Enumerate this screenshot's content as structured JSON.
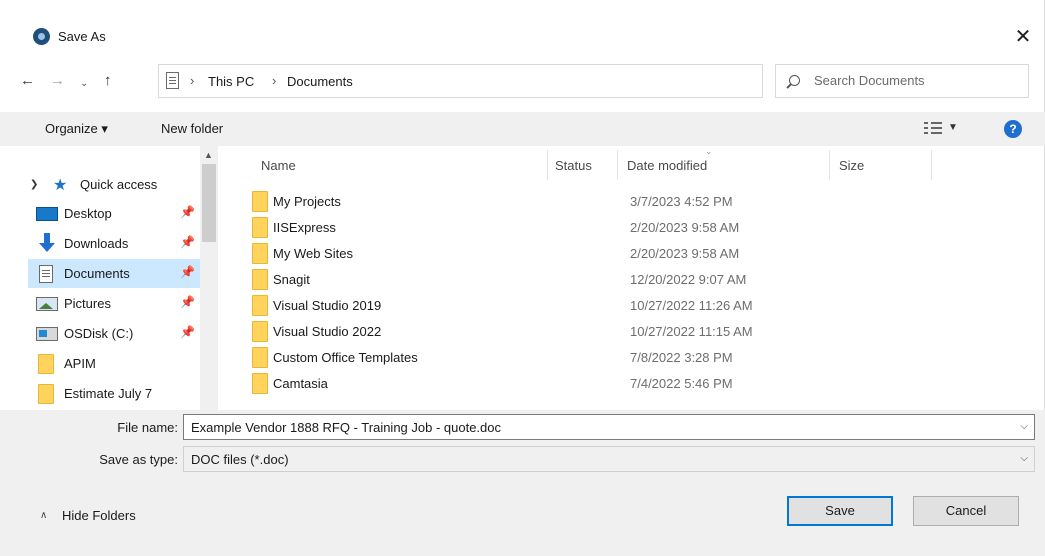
{
  "window": {
    "title": "Save As",
    "close_glyph": "✕"
  },
  "nav": {
    "back_glyph": "←",
    "forward_glyph": "→",
    "recent_glyph": "⌄",
    "up_glyph": "↑",
    "breadcrumbs": [
      "This PC",
      "Documents"
    ],
    "separator": "›",
    "search_placeholder": "Search Documents"
  },
  "toolbar": {
    "organize_label": "Organize ▾",
    "new_folder_label": "New folder",
    "view_caret": "▼",
    "help_label": "?"
  },
  "sidebar": {
    "quick_access_label": "Quick access",
    "items": [
      {
        "label": "Desktop",
        "icon": "desktop-icon",
        "pinned": true
      },
      {
        "label": "Downloads",
        "icon": "downloads-icon",
        "pinned": true
      },
      {
        "label": "Documents",
        "icon": "documents-icon",
        "pinned": true,
        "selected": true
      },
      {
        "label": "Pictures",
        "icon": "pictures-icon",
        "pinned": true
      },
      {
        "label": "OSDisk (C:)",
        "icon": "disk-icon",
        "pinned": true
      },
      {
        "label": "APIM",
        "icon": "folder-icon",
        "pinned": false
      },
      {
        "label": "Estimate July 7",
        "icon": "folder-icon",
        "pinned": false
      }
    ]
  },
  "columns": [
    "Name",
    "Status",
    "Date modified",
    "Size"
  ],
  "files": [
    {
      "name": "My Projects",
      "date": "3/7/2023 4:52 PM"
    },
    {
      "name": "IISExpress",
      "date": "2/20/2023 9:58 AM"
    },
    {
      "name": "My Web Sites",
      "date": "2/20/2023 9:58 AM"
    },
    {
      "name": "Snagit",
      "date": "12/20/2022 9:07 AM"
    },
    {
      "name": "Visual Studio 2019",
      "date": "10/27/2022 11:26 AM"
    },
    {
      "name": "Visual Studio 2022",
      "date": "10/27/2022 11:15 AM"
    },
    {
      "name": "Custom Office Templates",
      "date": "7/8/2022 3:28 PM"
    },
    {
      "name": "Camtasia",
      "date": "7/4/2022 5:46 PM"
    }
  ],
  "form": {
    "file_name_label": "File name:",
    "file_name_value": "Example Vendor 1888 RFQ - Training Job - quote.doc",
    "save_type_label": "Save as type:",
    "save_type_value": "DOC files (*.doc)",
    "hide_folders_label": "Hide Folders",
    "save_label": "Save",
    "cancel_label": "Cancel"
  },
  "colors": {
    "accent": "#0078d7",
    "selection": "#cce8ff",
    "folder": "#ffd35c"
  }
}
